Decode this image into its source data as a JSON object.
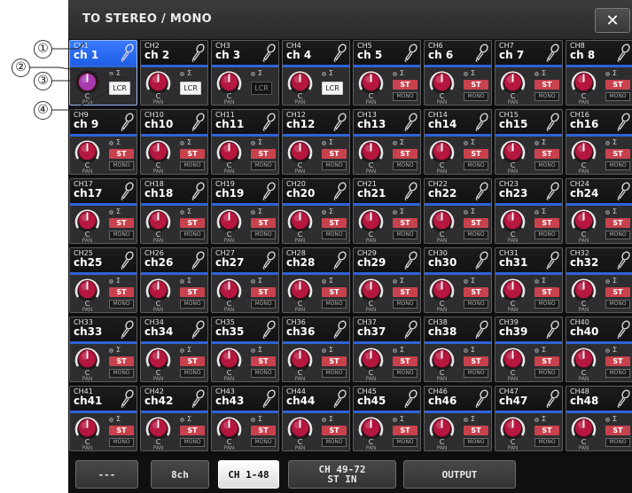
{
  "window": {
    "title": "TO STEREO / MONO",
    "close_glyph": "✕"
  },
  "channels": [
    {
      "number": "CH1",
      "name": "ch 1",
      "selected": true,
      "mode": "lcr",
      "lcr_on": true,
      "pan_value": "C",
      "pan_label": "PAN",
      "knob_style": "purple",
      "sigma": "Σ"
    },
    {
      "number": "CH2",
      "name": "ch 2",
      "selected": false,
      "mode": "lcr",
      "lcr_on": true,
      "pan_value": "C",
      "pan_label": "PAN",
      "knob_style": "red",
      "sigma": "Σ"
    },
    {
      "number": "CH3",
      "name": "ch 3",
      "selected": false,
      "mode": "lcr",
      "lcr_on": false,
      "pan_value": "C",
      "pan_label": "PAN",
      "knob_style": "red",
      "sigma": "Σ"
    },
    {
      "number": "CH4",
      "name": "ch 4",
      "selected": false,
      "mode": "lcr",
      "lcr_on": true,
      "pan_value": "C",
      "pan_label": "PAN",
      "knob_style": "red",
      "sigma": "Σ"
    },
    {
      "number": "CH5",
      "name": "ch 5",
      "selected": false,
      "mode": "st",
      "pan_value": "C",
      "pan_label": "PAN",
      "knob_style": "red",
      "sigma": "Σ"
    },
    {
      "number": "CH6",
      "name": "ch 6",
      "selected": false,
      "mode": "st",
      "pan_value": "C",
      "pan_label": "PAN",
      "knob_style": "red",
      "sigma": "Σ"
    },
    {
      "number": "CH7",
      "name": "ch 7",
      "selected": false,
      "mode": "st",
      "pan_value": "C",
      "pan_label": "PAN",
      "knob_style": "red",
      "sigma": "Σ"
    },
    {
      "number": "CH8",
      "name": "ch 8",
      "selected": false,
      "mode": "st",
      "pan_value": "C",
      "pan_label": "PAN",
      "knob_style": "red",
      "sigma": "Σ"
    },
    {
      "number": "CH9",
      "name": "ch 9",
      "mode": "st",
      "pan_value": "C",
      "pan_label": "PAN",
      "sigma": "Σ"
    },
    {
      "number": "CH10",
      "name": "ch10",
      "mode": "st",
      "pan_value": "C",
      "pan_label": "PAN",
      "sigma": "Σ"
    },
    {
      "number": "CH11",
      "name": "ch11",
      "mode": "st",
      "pan_value": "C",
      "pan_label": "PAN",
      "sigma": "Σ"
    },
    {
      "number": "CH12",
      "name": "ch12",
      "mode": "st",
      "pan_value": "C",
      "pan_label": "PAN",
      "sigma": "Σ"
    },
    {
      "number": "CH13",
      "name": "ch13",
      "mode": "st",
      "pan_value": "C",
      "pan_label": "PAN",
      "sigma": "Σ"
    },
    {
      "number": "CH14",
      "name": "ch14",
      "mode": "st",
      "pan_value": "C",
      "pan_label": "PAN",
      "sigma": "Σ"
    },
    {
      "number": "CH15",
      "name": "ch15",
      "mode": "st",
      "pan_value": "C",
      "pan_label": "PAN",
      "sigma": "Σ"
    },
    {
      "number": "CH16",
      "name": "ch16",
      "mode": "st",
      "pan_value": "C",
      "pan_label": "PAN",
      "sigma": "Σ"
    },
    {
      "number": "CH17",
      "name": "ch17",
      "mode": "st",
      "pan_value": "C",
      "pan_label": "PAN",
      "sigma": "Σ"
    },
    {
      "number": "CH18",
      "name": "ch18",
      "mode": "st",
      "pan_value": "C",
      "pan_label": "PAN",
      "sigma": "Σ"
    },
    {
      "number": "CH19",
      "name": "ch19",
      "mode": "st",
      "pan_value": "C",
      "pan_label": "PAN",
      "sigma": "Σ"
    },
    {
      "number": "CH20",
      "name": "ch20",
      "mode": "st",
      "pan_value": "C",
      "pan_label": "PAN",
      "sigma": "Σ"
    },
    {
      "number": "CH21",
      "name": "ch21",
      "mode": "st",
      "pan_value": "C",
      "pan_label": "PAN",
      "sigma": "Σ"
    },
    {
      "number": "CH22",
      "name": "ch22",
      "mode": "st",
      "pan_value": "C",
      "pan_label": "PAN",
      "sigma": "Σ"
    },
    {
      "number": "CH23",
      "name": "ch23",
      "mode": "st",
      "pan_value": "C",
      "pan_label": "PAN",
      "sigma": "Σ"
    },
    {
      "number": "CH24",
      "name": "ch24",
      "mode": "st",
      "pan_value": "C",
      "pan_label": "PAN",
      "sigma": "Σ"
    },
    {
      "number": "CH25",
      "name": "ch25",
      "mode": "st",
      "pan_value": "C",
      "pan_label": "PAN",
      "sigma": "Σ"
    },
    {
      "number": "CH26",
      "name": "ch26",
      "mode": "st",
      "pan_value": "C",
      "pan_label": "PAN",
      "sigma": "Σ"
    },
    {
      "number": "CH27",
      "name": "ch27",
      "mode": "st",
      "pan_value": "C",
      "pan_label": "PAN",
      "sigma": "Σ"
    },
    {
      "number": "CH28",
      "name": "ch28",
      "mode": "st",
      "pan_value": "C",
      "pan_label": "PAN",
      "sigma": "Σ"
    },
    {
      "number": "CH29",
      "name": "ch29",
      "mode": "st",
      "pan_value": "C",
      "pan_label": "PAN",
      "sigma": "Σ"
    },
    {
      "number": "CH30",
      "name": "ch30",
      "mode": "st",
      "pan_value": "C",
      "pan_label": "PAN",
      "sigma": "Σ"
    },
    {
      "number": "CH31",
      "name": "ch31",
      "mode": "st",
      "pan_value": "C",
      "pan_label": "PAN",
      "sigma": "Σ"
    },
    {
      "number": "CH32",
      "name": "ch32",
      "mode": "st",
      "pan_value": "C",
      "pan_label": "PAN",
      "sigma": "Σ"
    },
    {
      "number": "CH33",
      "name": "ch33",
      "mode": "st",
      "pan_value": "C",
      "pan_label": "PAN",
      "sigma": "Σ"
    },
    {
      "number": "CH34",
      "name": "ch34",
      "mode": "st",
      "pan_value": "C",
      "pan_label": "PAN",
      "sigma": "Σ"
    },
    {
      "number": "CH35",
      "name": "ch35",
      "mode": "st",
      "pan_value": "C",
      "pan_label": "PAN",
      "sigma": "Σ"
    },
    {
      "number": "CH36",
      "name": "ch36",
      "mode": "st",
      "pan_value": "C",
      "pan_label": "PAN",
      "sigma": "Σ"
    },
    {
      "number": "CH37",
      "name": "ch37",
      "mode": "st",
      "pan_value": "C",
      "pan_label": "PAN",
      "sigma": "Σ"
    },
    {
      "number": "CH38",
      "name": "ch38",
      "mode": "st",
      "pan_value": "C",
      "pan_label": "PAN",
      "sigma": "Σ"
    },
    {
      "number": "CH39",
      "name": "ch39",
      "mode": "st",
      "pan_value": "C",
      "pan_label": "PAN",
      "sigma": "Σ"
    },
    {
      "number": "CH40",
      "name": "ch40",
      "mode": "st",
      "pan_value": "C",
      "pan_label": "PAN",
      "sigma": "Σ"
    },
    {
      "number": "CH41",
      "name": "ch41",
      "mode": "st",
      "pan_value": "C",
      "pan_label": "PAN",
      "sigma": "Σ"
    },
    {
      "number": "CH42",
      "name": "ch42",
      "mode": "st",
      "pan_value": "C",
      "pan_label": "PAN",
      "sigma": "Σ"
    },
    {
      "number": "CH43",
      "name": "ch43",
      "mode": "st",
      "pan_value": "C",
      "pan_label": "PAN",
      "sigma": "Σ"
    },
    {
      "number": "CH44",
      "name": "ch44",
      "mode": "st",
      "pan_value": "C",
      "pan_label": "PAN",
      "sigma": "Σ"
    },
    {
      "number": "CH45",
      "name": "ch45",
      "mode": "st",
      "pan_value": "C",
      "pan_label": "PAN",
      "sigma": "Σ"
    },
    {
      "number": "CH46",
      "name": "ch46",
      "mode": "st",
      "pan_value": "C",
      "pan_label": "PAN",
      "sigma": "Σ"
    },
    {
      "number": "CH47",
      "name": "ch47",
      "mode": "st",
      "pan_value": "C",
      "pan_label": "PAN",
      "sigma": "Σ"
    },
    {
      "number": "CH48",
      "name": "ch48",
      "mode": "st",
      "pan_value": "C",
      "pan_label": "PAN",
      "sigma": "Σ"
    }
  ],
  "labels": {
    "st": "ST",
    "mono": "MONO",
    "lcr": "LCR"
  },
  "tabs": [
    {
      "label": "---",
      "active": false
    },
    {
      "label": "8ch",
      "active": false
    },
    {
      "label": "CH 1-48",
      "active": true
    },
    {
      "label": "CH 49-72\nST IN",
      "active": false
    },
    {
      "label": "OUTPUT",
      "active": false
    }
  ],
  "callouts": [
    "①",
    "②",
    "③",
    "④"
  ],
  "colors": {
    "accent_blue": "#2f63d8",
    "st_red": "#c8424d",
    "knob_red": "#b5173f",
    "selected_purple": "#a83ab0"
  },
  "icons": {
    "channel": "microphone-icon",
    "close": "close-icon"
  }
}
